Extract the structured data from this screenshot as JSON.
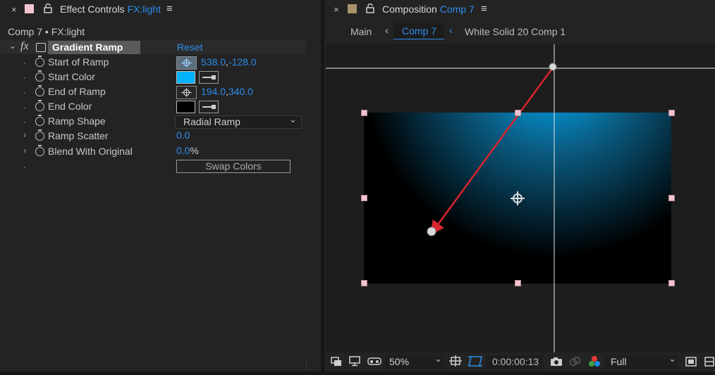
{
  "effect_controls": {
    "tab_title": "Effect Controls",
    "tab_layer": "FX:light",
    "breadcrumb": "Comp 7 • FX:light",
    "effect_name": "Gradient Ramp",
    "fx_glyph": "fx",
    "reset_label": "Reset",
    "label_color": "#f3c4cf",
    "properties": {
      "start_of_ramp": {
        "label": "Start of Ramp",
        "x": "538.0",
        "sep": ",",
        "y": "-128.0"
      },
      "start_color": {
        "label": "Start Color",
        "color": "#00b2ff"
      },
      "end_of_ramp": {
        "label": "End of Ramp",
        "x": "194.0",
        "sep": ",",
        "y": "340.0"
      },
      "end_color": {
        "label": "End Color",
        "color": "#000000"
      },
      "ramp_shape": {
        "label": "Ramp Shape",
        "value": "Radial Ramp"
      },
      "ramp_scatter": {
        "label": "Ramp Scatter",
        "value": "0.0"
      },
      "blend_with_original": {
        "label": "Blend With Original",
        "value": "0.0",
        "unit": "%"
      }
    },
    "swap_colors_label": "Swap Colors"
  },
  "composition": {
    "tab_title": "Composition",
    "tab_comp": "Comp 7",
    "label_color": "#a8916b",
    "nav": {
      "main": "Main",
      "current": "Comp 7",
      "next": "White Solid 20 Comp 1"
    }
  },
  "viewer_toolbar": {
    "zoom": "50%",
    "timecode": "0:00:00:13",
    "resolution": "Full"
  },
  "icons": {
    "close": "close-icon",
    "lock": "lock-icon",
    "menu": "menu-icon",
    "stopwatch": "stopwatch-icon",
    "crosshair": "crosshair-icon",
    "eyedropper": "eyedropper-icon",
    "camera": "snapshot-camera-icon",
    "color_channels": "rgb-channels-icon"
  }
}
